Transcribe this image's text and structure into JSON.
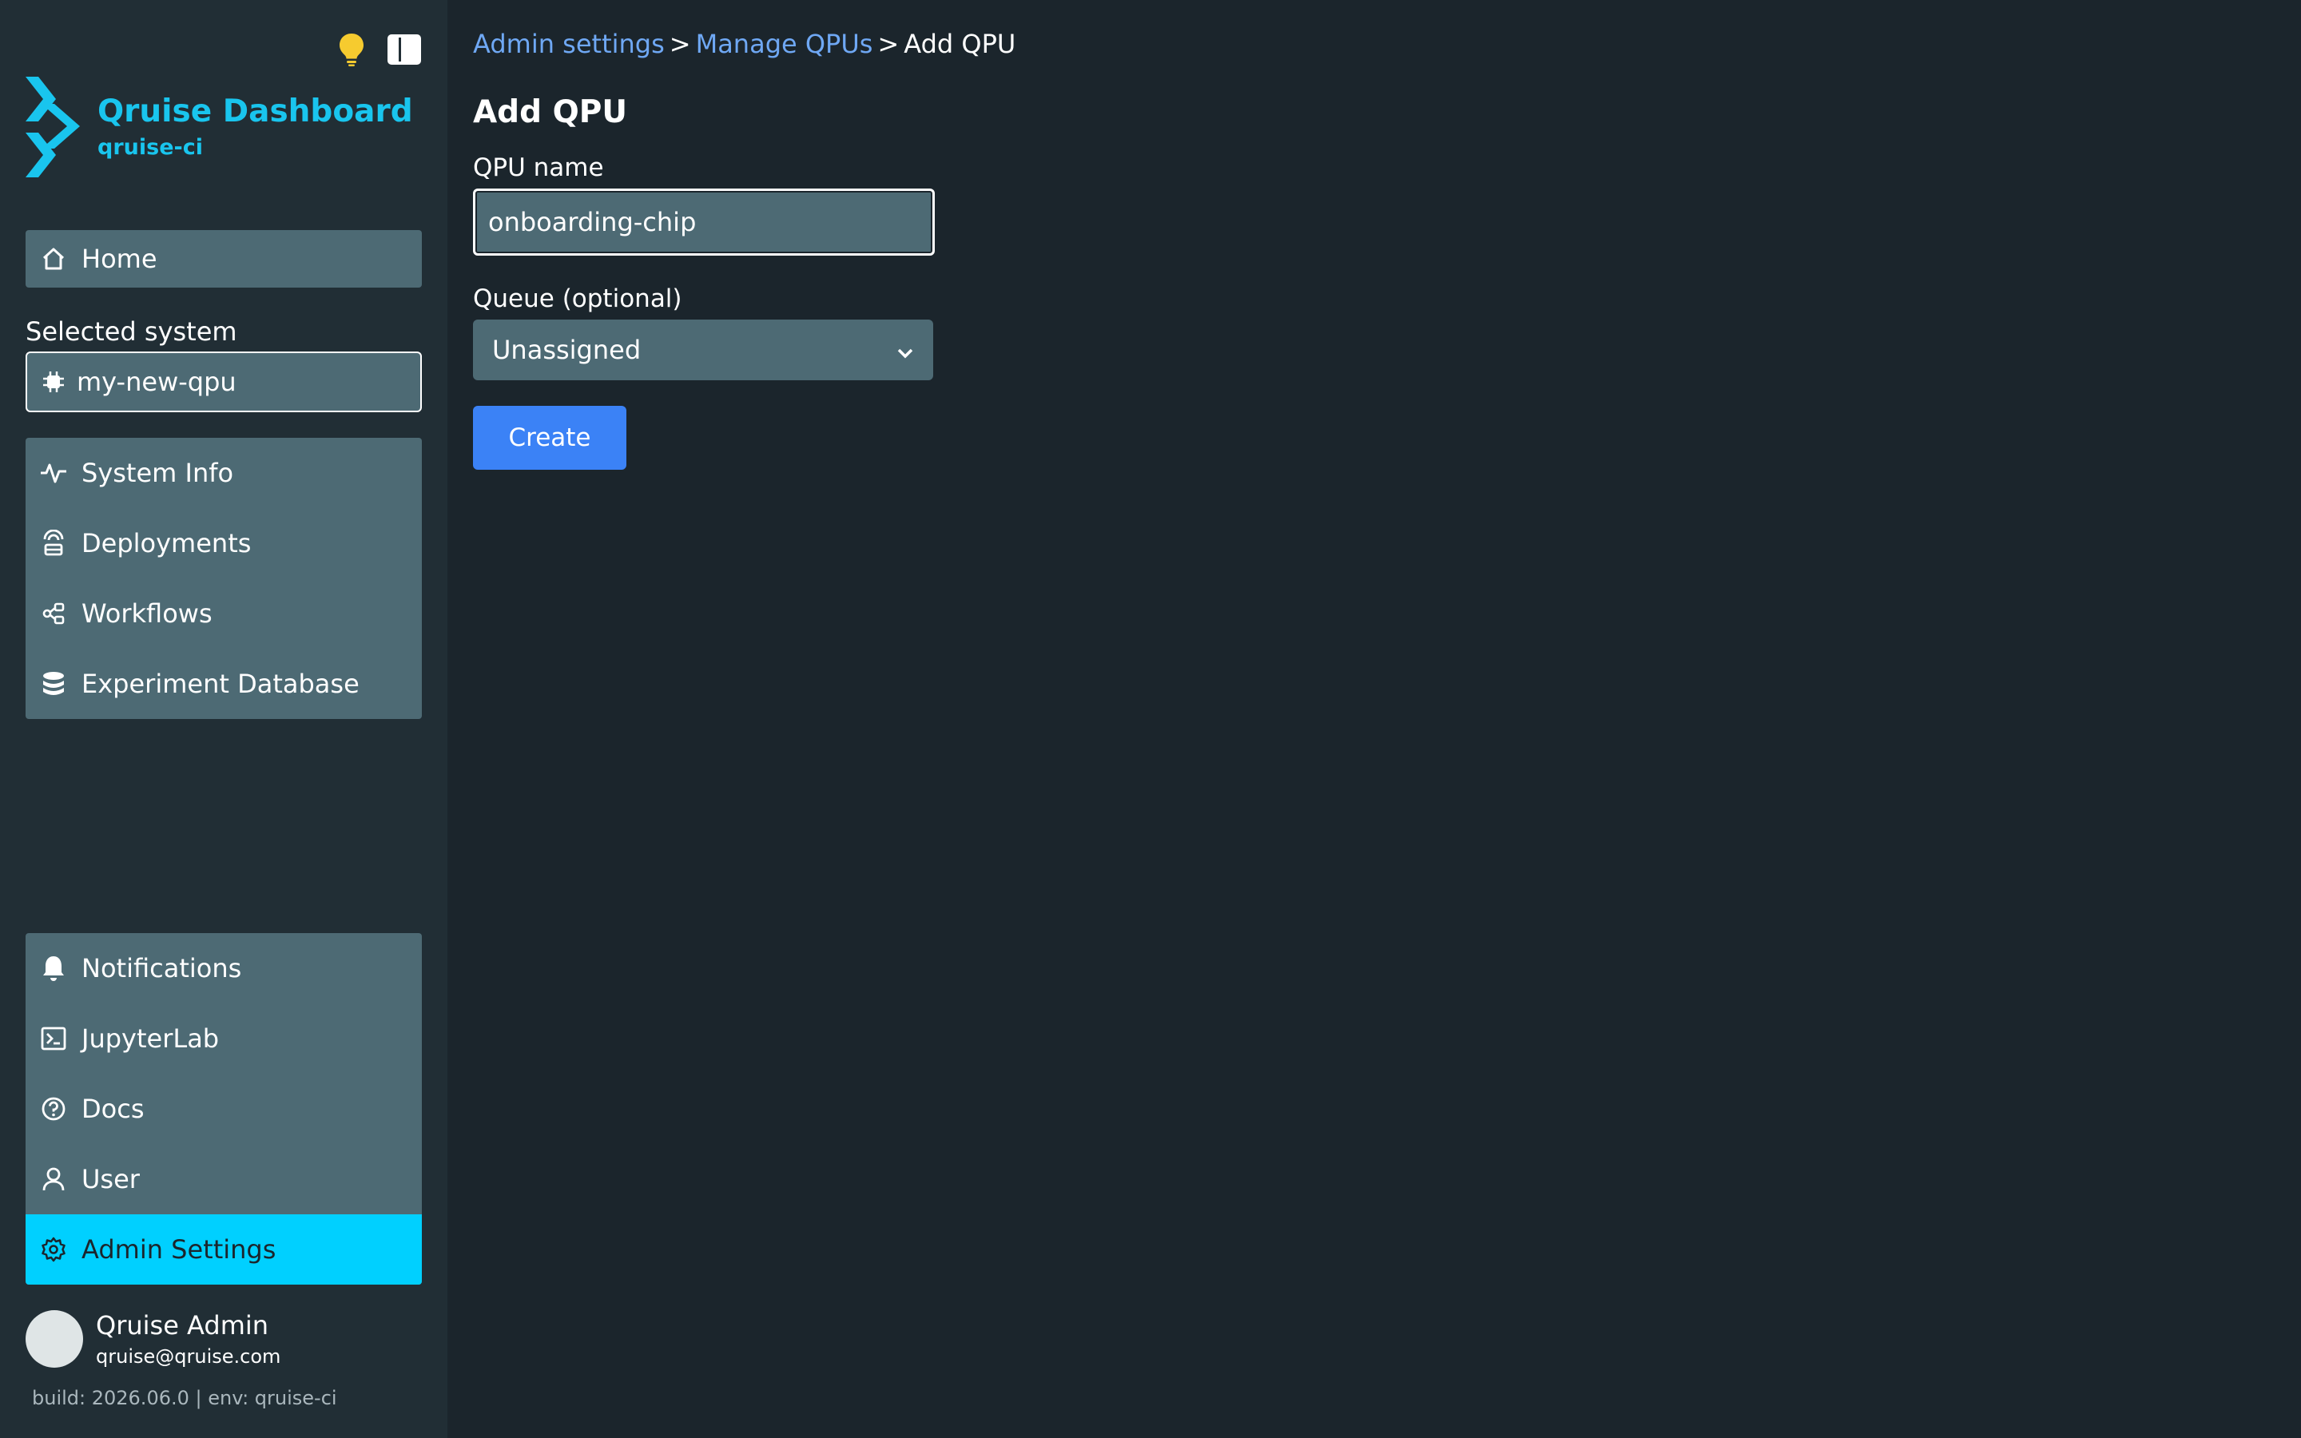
{
  "app": {
    "title": "Qruise Dashboard",
    "org": "qruise-ci"
  },
  "sidebar": {
    "home_label": "Home",
    "selected_system_label": "Selected system",
    "selected_system_value": "my-new-qpu",
    "system_items": [
      {
        "label": "System Info",
        "icon": "activity-icon"
      },
      {
        "label": "Deployments",
        "icon": "deployment-icon"
      },
      {
        "label": "Workflows",
        "icon": "workflow-icon"
      },
      {
        "label": "Experiment Database",
        "icon": "database-icon"
      }
    ],
    "bottom_items": [
      {
        "label": "Notifications",
        "icon": "bell-icon"
      },
      {
        "label": "JupyterLab",
        "icon": "terminal-icon"
      },
      {
        "label": "Docs",
        "icon": "help-circle-icon"
      },
      {
        "label": "User",
        "icon": "user-icon"
      },
      {
        "label": "Admin Settings",
        "icon": "gear-icon",
        "active": true
      }
    ],
    "user": {
      "name": "Qruise Admin",
      "email": "qruise@qruise.com"
    },
    "build_info": "build: 2026.06.0 | env: qruise-ci"
  },
  "main": {
    "breadcrumb": [
      "Admin settings",
      "Manage QPUs",
      "Add QPU"
    ],
    "breadcrumb_sep": ">",
    "page_title": "Add QPU",
    "qpu_name_label": "QPU name",
    "qpu_name_value": "onboarding-chip",
    "queue_label": "Queue (optional)",
    "queue_value": "Unassigned",
    "create_label": "Create"
  },
  "colors": {
    "accent": "#19c5ee",
    "active_nav": "#00d0ff",
    "primary_button": "#3b82f6",
    "link": "#6fa8f4",
    "panel": "#4d6a74"
  }
}
